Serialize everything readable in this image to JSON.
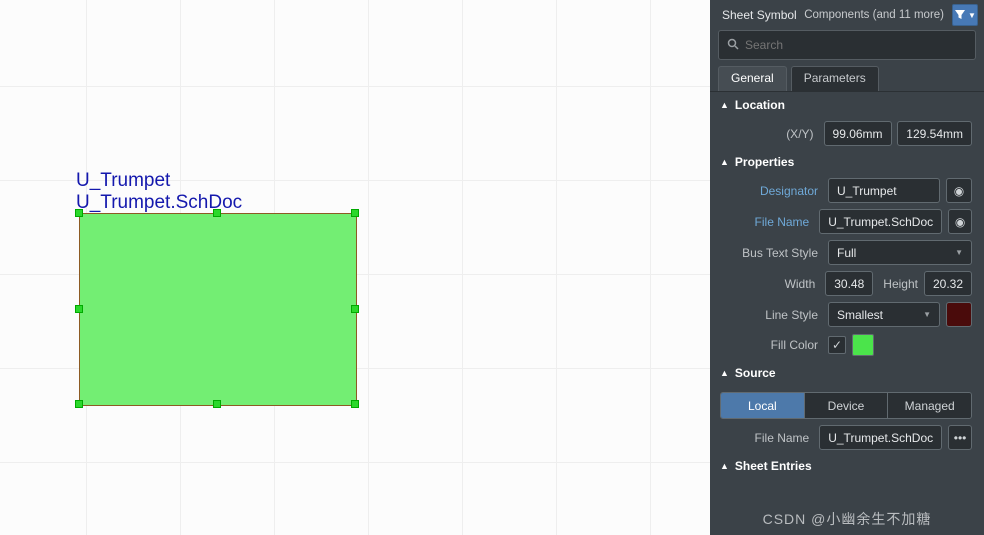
{
  "canvas": {
    "designator_text": "U_Trumpet",
    "filename_text": "U_Trumpet.SchDoc"
  },
  "panel": {
    "title": "Sheet Symbol",
    "more_text": "Components (and 11 more)",
    "search_placeholder": "Search",
    "tabs": {
      "general": "General",
      "parameters": "Parameters"
    },
    "sections": {
      "location": {
        "title": "Location",
        "xy_label": "(X/Y)",
        "x": "99.06mm",
        "y": "129.54mm"
      },
      "properties": {
        "title": "Properties",
        "designator_label": "Designator",
        "designator_value": "U_Trumpet",
        "filename_label": "File Name",
        "filename_value": "U_Trumpet.SchDoc",
        "bus_label": "Bus Text Style",
        "bus_value": "Full",
        "width_label": "Width",
        "width_value": "30.48",
        "height_label": "Height",
        "height_value": "20.32",
        "linestyle_label": "Line Style",
        "linestyle_value": "Smallest",
        "fill_label": "Fill Color"
      },
      "source": {
        "title": "Source",
        "local": "Local",
        "device": "Device",
        "managed": "Managed",
        "filename_label": "File Name",
        "filename_value": "U_Trumpet.SchDoc"
      },
      "sheet": {
        "title": "Sheet Entries"
      }
    }
  },
  "watermark": "CSDN @小幽余生不加糖",
  "colors": {
    "line_swatch": "#4a0b0b",
    "fill_swatch": "#4be44b"
  }
}
